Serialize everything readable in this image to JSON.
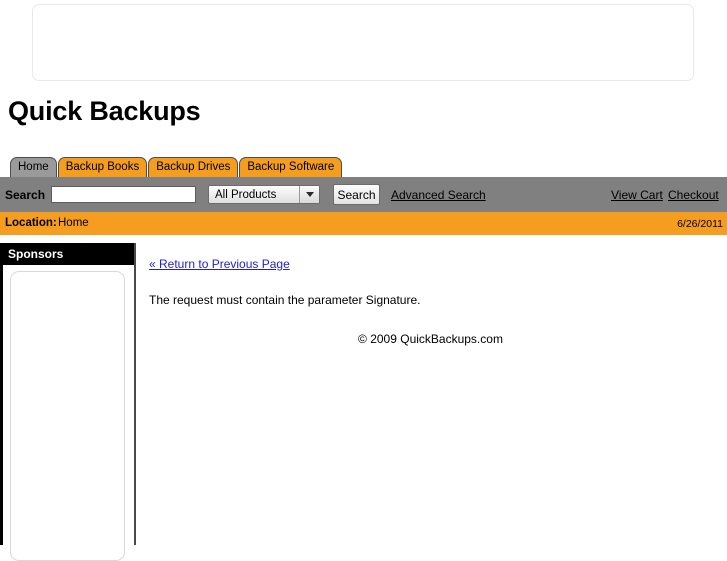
{
  "site": {
    "title": "Quick Backups"
  },
  "banner": {
    "placeholder_label": ""
  },
  "tabs": [
    {
      "label": "Home",
      "active": true
    },
    {
      "label": "Backup Books",
      "active": false
    },
    {
      "label": "Backup Drives",
      "active": false
    },
    {
      "label": "Backup Software",
      "active": false
    }
  ],
  "search": {
    "label": "Search",
    "input_value": "",
    "placeholder": "",
    "category_selected": "All Products",
    "category_options": [
      "All Products"
    ],
    "button_label": "Search",
    "advanced_link": "Advanced Search"
  },
  "account": {
    "view_cart": "View Cart",
    "checkout": "Checkout"
  },
  "location": {
    "label": "Location:",
    "value": "Home",
    "date": "6/26/2011"
  },
  "sidebar": {
    "header": "Sponsors"
  },
  "main": {
    "return_link": "« Return to Previous Page",
    "error_message": "The request must contain the parameter Signature.",
    "copyright": "© 2009 QuickBackups.com"
  },
  "colors": {
    "orange": "#f59d1f",
    "gray_bar": "#808080",
    "tab_active": "#9a9a9a",
    "link_blue": "#2222cc",
    "black": "#000000"
  }
}
